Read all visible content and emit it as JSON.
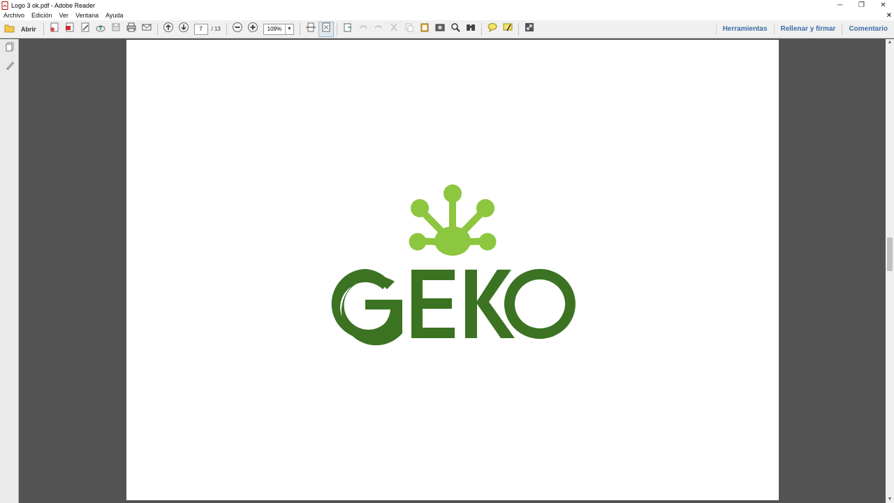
{
  "window": {
    "title": "Logo 3 ok.pdf - Adobe Reader",
    "controls": [
      "minimize",
      "restore",
      "close"
    ]
  },
  "menu": {
    "items": [
      "Archivo",
      "Edición",
      "Ver",
      "Ventana",
      "Ayuda"
    ]
  },
  "toolbar": {
    "open_label": "Abrir",
    "page_current": "7",
    "page_total": "/ 13",
    "zoom": "109%",
    "right_links": [
      "Herramientas",
      "Rellenar y firmar",
      "Comentario"
    ]
  },
  "document": {
    "logo_text": "GEKO",
    "colors": {
      "logo_light_green": "#8dc63f",
      "logo_dark_green": "#3b7322",
      "accent_link": "#3f6ea5"
    }
  }
}
